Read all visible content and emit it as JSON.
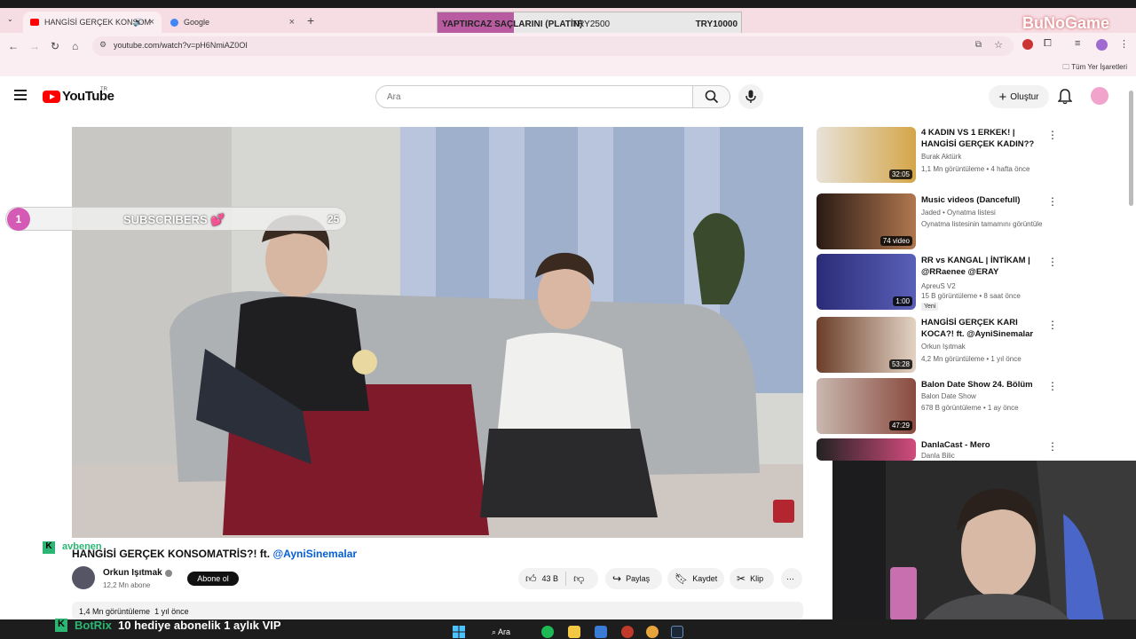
{
  "browser": {
    "tabs": [
      {
        "label": "HANGİSİ GERÇEK KONSOM",
        "favicon": "youtube-icon"
      },
      {
        "label": "Google",
        "favicon": "google-icon"
      }
    ],
    "url": "youtube.com/watch?v=pH6NmiAZ0OI",
    "bookmarks_all": "Tüm Yer İşaretleri"
  },
  "overlay": {
    "goal_label": "YAPTIRCAZ SAÇLARINI (PLATİN)",
    "goal_current": "TRY2500",
    "goal_target": "TRY10000",
    "goal_progress": 0.25,
    "brand": "BuNoGame",
    "subs_rank": "1",
    "subs_label": "SUBSCRIBERS 💕",
    "subs_count": "25",
    "chat_user": "avbenen",
    "botrix_name": "BotRix",
    "botrix_msg": "10 hediye abonelik 1 aylık VIP"
  },
  "youtube": {
    "logo_text": "YouTube",
    "region": "TR",
    "search_placeholder": "Ara",
    "create_label": "Oluştur",
    "video": {
      "title_prefix": "HANGİSİ GERÇEK KONSOMATRİS?! ft. ",
      "title_mention": "@AyniSinemalar",
      "channel": "Orkun Işıtmak",
      "subscribers": "12,2 Mn abone",
      "subscribe_label": "Abone ol",
      "likes": "43 B",
      "share_label": "Paylaş",
      "save_label": "Kaydet",
      "clip_label": "Klip",
      "views": "1,4 Mn görüntüleme",
      "age": "1 yıl önce"
    },
    "recommendations": [
      {
        "title": "4 KADIN VS 1 ERKEK! | HANGİSİ GERÇEK KADIN??",
        "channel": "Burak Aktürk",
        "meta": "1,1 Mn görüntüleme • 4 hafta önce",
        "duration": "32:05",
        "verified": true
      },
      {
        "title": "Music videos (Dancefull)",
        "channel": "Jaded • Oynatma listesi",
        "meta": "Oynatma listesinin tamamını görüntüle",
        "duration": "74 video",
        "verified": false
      },
      {
        "title": "RR vs KANGAL | İNTİKAM | @RRaenee @ERAY",
        "channel": "ApreuS V2",
        "meta": "15 B görüntüleme • 8 saat önce",
        "duration": "1:00",
        "badge": "Yeni",
        "verified": false
      },
      {
        "title": "HANGİSİ GERÇEK KARI KOCA?! ft. @AyniSinemalar",
        "channel": "Orkun Işıtmak",
        "meta": "4,2 Mn görüntüleme • 1 yıl önce",
        "duration": "53:28",
        "verified": true
      },
      {
        "title": "Balon Date Show 24. Bölüm",
        "channel": "Balon Date Show",
        "meta": "678 B görüntüleme • 1 ay önce",
        "duration": "47:29",
        "verified": false
      },
      {
        "title": "DanlaCast - Mero",
        "channel": "Danla Bilic",
        "meta": "",
        "duration": "",
        "verified": true
      }
    ]
  },
  "taskbar": {
    "search_label": "Ara"
  },
  "colors": {
    "accent_red": "#ff0000",
    "mention_blue": "#065fd4",
    "goal_fill": "#b85ba0",
    "kick_green": "#2bb673"
  }
}
